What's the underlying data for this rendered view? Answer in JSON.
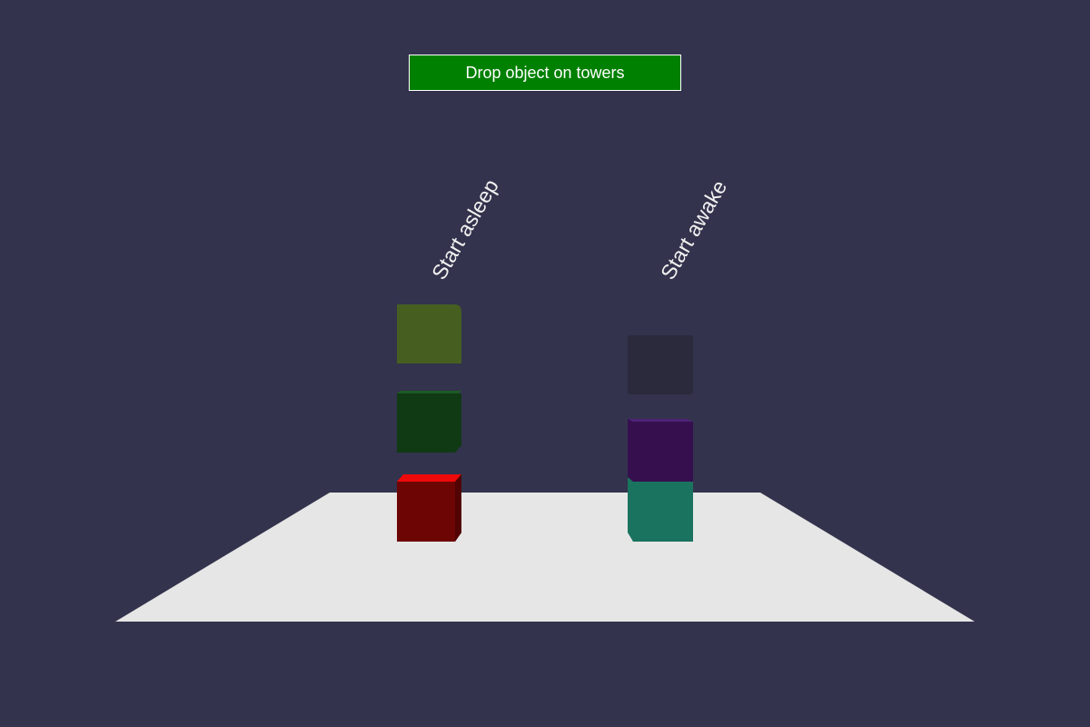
{
  "toolbar": {
    "drop_label": "Drop object on towers",
    "drop_color": "#008000"
  },
  "scene": {
    "background_color": "#33334d",
    "floor_color": "#e6e6e6"
  },
  "towers": [
    {
      "label": "Start asleep",
      "blocks": [
        {
          "name": "red-block",
          "color": "#6e0505"
        },
        {
          "name": "dark-green-block",
          "color": "#0f3a14"
        },
        {
          "name": "olive-block",
          "color": "#465f20"
        }
      ]
    },
    {
      "label": "Start awake",
      "blocks": [
        {
          "name": "teal-block",
          "color": "#1a735e"
        },
        {
          "name": "purple-block",
          "color": "#360f4f"
        },
        {
          "name": "dark-gray-block",
          "color": "#2b2a3c"
        }
      ]
    }
  ]
}
